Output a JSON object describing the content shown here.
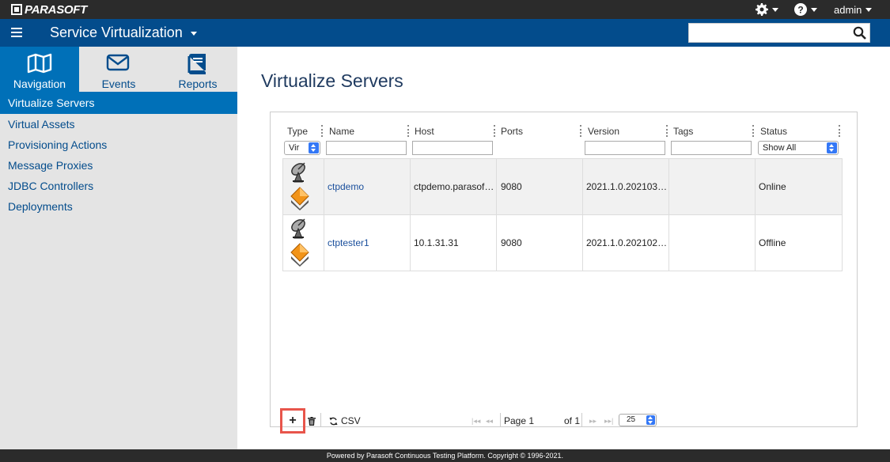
{
  "brand": {
    "logo": "PARASOFT"
  },
  "topbar": {
    "user": "admin"
  },
  "app": {
    "title": "Service Virtualization"
  },
  "search": {
    "placeholder": ""
  },
  "sidebar": {
    "tabs": [
      {
        "label": "Navigation",
        "icon": "map-icon"
      },
      {
        "label": "Events",
        "icon": "envelope-icon"
      },
      {
        "label": "Reports",
        "icon": "book-icon"
      }
    ],
    "items": [
      {
        "label": "Virtualize Servers"
      },
      {
        "label": "Virtual Assets"
      },
      {
        "label": "Provisioning Actions"
      },
      {
        "label": "Message Proxies"
      },
      {
        "label": "JDBC Controllers"
      },
      {
        "label": "Deployments"
      }
    ]
  },
  "page": {
    "title": "Virtualize Servers"
  },
  "table": {
    "columns": [
      "Type",
      "Name",
      "Host",
      "Ports",
      "Version",
      "Tags",
      "Status"
    ],
    "filters": {
      "type": "Vir",
      "status": "Show All"
    },
    "rows": [
      {
        "name": "ctpdemo",
        "host": "ctpdemo.parasof…",
        "ports": "9080",
        "version": "2021.1.0.202103…",
        "tags": "",
        "status": "Online"
      },
      {
        "name": "ctptester1",
        "host": "10.1.31.31",
        "ports": "9080",
        "version": "2021.1.0.202102…",
        "tags": "",
        "status": "Offline"
      }
    ]
  },
  "toolbar": {
    "add": "+",
    "csv": "CSV",
    "page_label": "Page 1",
    "of_label": "of 1",
    "page_size": "25"
  },
  "footer": {
    "text": "Powered by Parasoft Continuous Testing Platform. Copyright © 1996-2021."
  },
  "colors": {
    "header": "#034c8c",
    "active": "#0070b8",
    "sidebar": "#e4e4e4",
    "highlight": "#e8554b"
  }
}
